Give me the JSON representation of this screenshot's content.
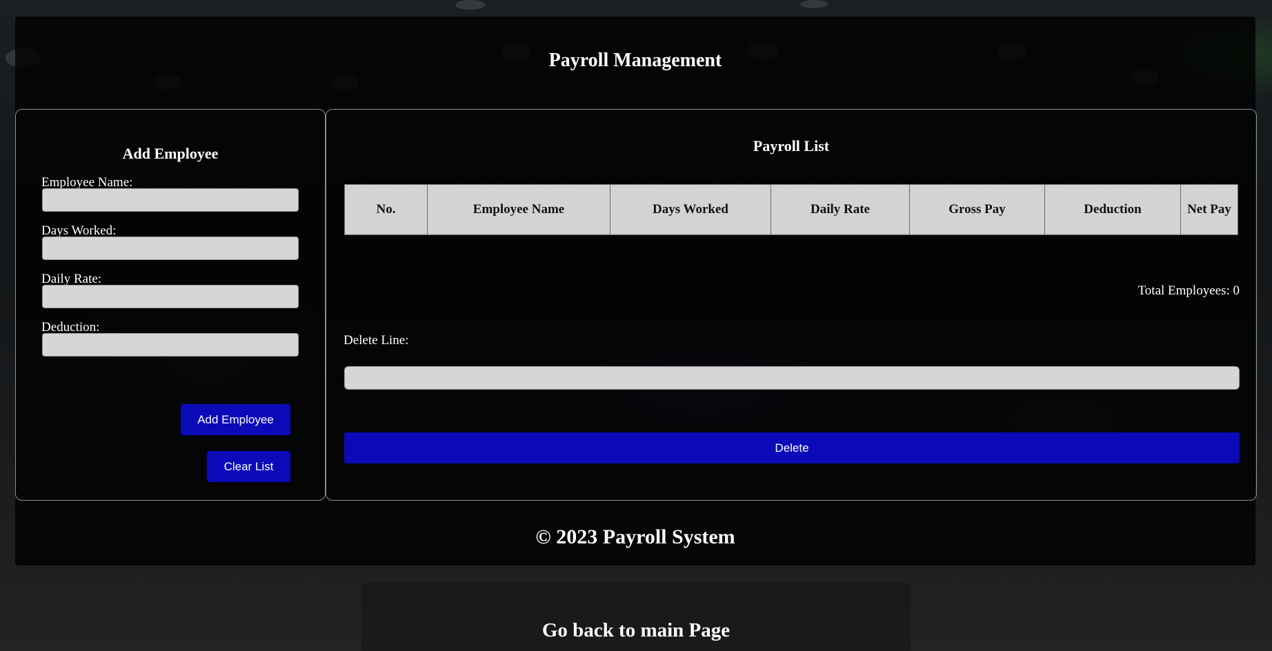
{
  "page_title": "Payroll Management",
  "add_employee": {
    "heading": "Add Employee",
    "fields": [
      {
        "label": "Employee Name:",
        "value": ""
      },
      {
        "label": "Days Worked:",
        "value": ""
      },
      {
        "label": "Daily Rate:",
        "value": ""
      },
      {
        "label": "Deduction:",
        "value": ""
      }
    ],
    "add_button": "Add Employee",
    "clear_button": "Clear List"
  },
  "payroll_list": {
    "heading": "Payroll List",
    "columns": [
      "No.",
      "Employee Name",
      "Days Worked",
      "Daily Rate",
      "Gross Pay",
      "Deduction",
      "Net Pay"
    ],
    "rows": [],
    "total_label": "Total Employees: 0",
    "delete_label": "Delete Line:",
    "delete_value": "",
    "delete_button": "Delete"
  },
  "footer": "© 2023 Payroll System",
  "back_link": "Go back to main Page",
  "colors": {
    "button": "#0a0ab8",
    "input_bg": "#d6d6d6",
    "table_bg": "#d3d3d3",
    "panel_bg": "#000000"
  }
}
